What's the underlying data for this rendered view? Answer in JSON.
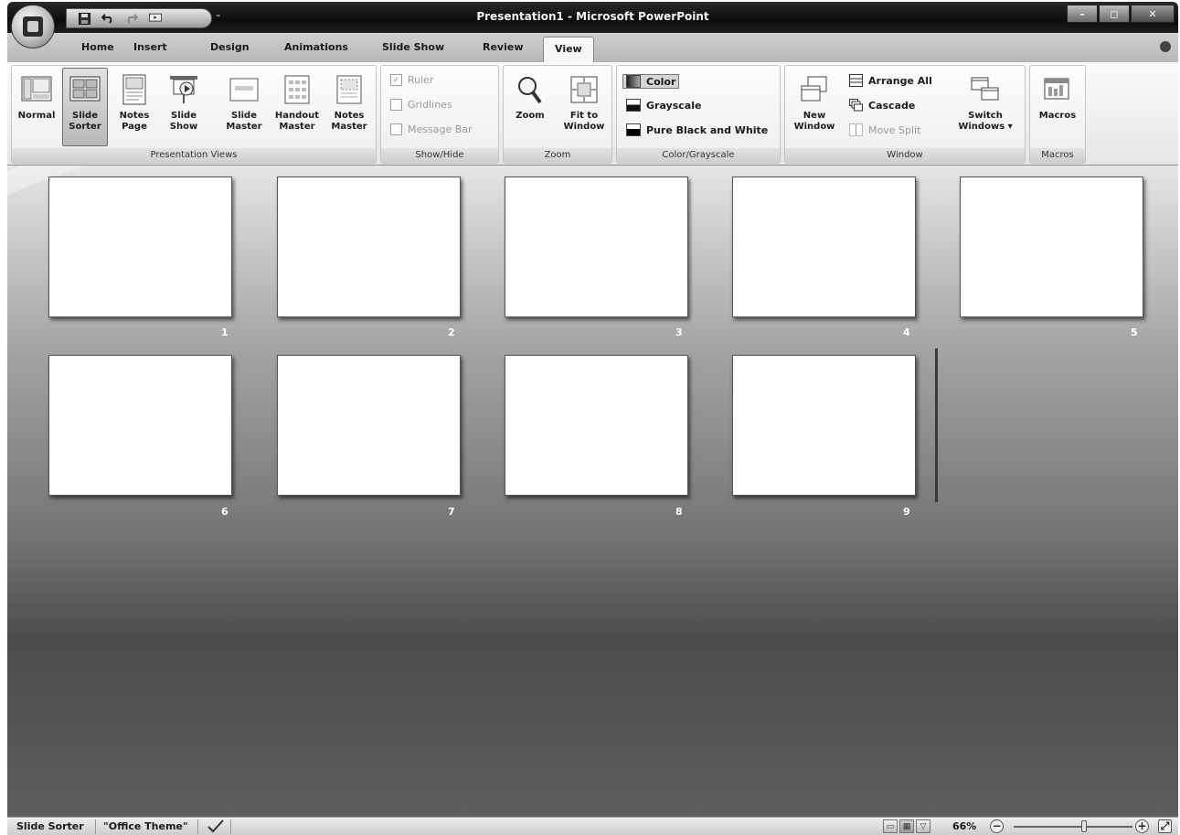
{
  "window": {
    "title": "Presentation1 - Microsoft PowerPoint",
    "controls": {
      "minimize": "–",
      "maximize": "◻",
      "close": "✕"
    }
  },
  "qat": {
    "save_icon": "save-icon",
    "undo_icon": "undo-icon",
    "redo_icon": "redo-icon",
    "slideshow_icon": "slideshow-icon",
    "more": "⁼"
  },
  "tabs": [
    "Home",
    "Insert",
    "Design",
    "Animations",
    "Slide Show",
    "Review",
    "View"
  ],
  "active_tab": "View",
  "ribbon": {
    "presentation_views": {
      "label": "Presentation Views",
      "normal": "Normal",
      "slide_sorter": [
        "Slide",
        "Sorter"
      ],
      "notes_page": [
        "Notes",
        "Page"
      ],
      "slide_show": [
        "Slide",
        "Show"
      ],
      "slide_master": [
        "Slide",
        "Master"
      ],
      "handout_master": [
        "Handout",
        "Master"
      ],
      "notes_master": [
        "Notes",
        "Master"
      ]
    },
    "show_hide": {
      "label": "Show/Hide",
      "ruler": "Ruler",
      "gridlines": "Gridlines",
      "message_bar": "Message Bar"
    },
    "zoom": {
      "label": "Zoom",
      "zoom": "Zoom",
      "fit_to_window": [
        "Fit to",
        "Window"
      ]
    },
    "color_grayscale": {
      "label": "Color/Grayscale",
      "color": "Color",
      "grayscale": "Grayscale",
      "pure_bw": "Pure Black and White"
    },
    "window": {
      "label": "Window",
      "new_window": [
        "New",
        "Window"
      ],
      "arrange_all": "Arrange All",
      "cascade": "Cascade",
      "move_split": "Move Split",
      "switch_windows": [
        "Switch",
        "Windows ▾"
      ]
    },
    "macros": {
      "label": "Macros",
      "macros": "Macros"
    }
  },
  "slides": [
    "1",
    "2",
    "3",
    "4",
    "5",
    "6",
    "7",
    "8",
    "9"
  ],
  "status": {
    "view": "Slide Sorter",
    "theme": "\"Office Theme\"",
    "zoom": "66%",
    "zoom_level": 0.66,
    "zoom_out": "−",
    "zoom_in": "+",
    "fit": "⤢"
  }
}
